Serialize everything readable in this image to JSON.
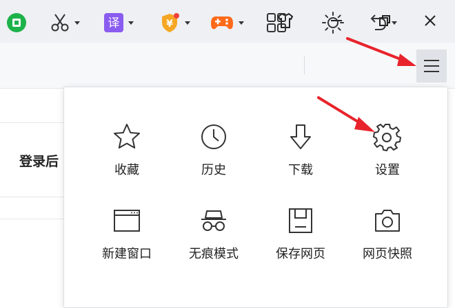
{
  "window": {
    "controls": [
      {
        "name": "skin-icon"
      },
      {
        "name": "minimize-icon"
      },
      {
        "name": "restore-icon"
      },
      {
        "name": "close-icon"
      }
    ]
  },
  "toolbar": {
    "tools": [
      {
        "name": "green-app-icon",
        "color": "#1db24a"
      },
      {
        "name": "scissors-icon",
        "color": "#333333"
      },
      {
        "name": "translate-icon",
        "glyph": "译",
        "color": "#8a5cf0"
      },
      {
        "name": "coupon-shield-icon",
        "glyph": "¥",
        "color": "#f5a623"
      },
      {
        "name": "game-controller-icon",
        "color": "#ff6a1a"
      },
      {
        "name": "grid-apps-icon",
        "color": "#333333"
      },
      {
        "name": "brightness-icon",
        "color": "#333333"
      },
      {
        "name": "undo-icon",
        "color": "#333333"
      },
      {
        "name": "hamburger-menu-icon",
        "color": "#333333"
      }
    ]
  },
  "background": {
    "partial_text": "登录后"
  },
  "menu": {
    "row1": [
      {
        "label": "收藏",
        "icon": "star-icon"
      },
      {
        "label": "历史",
        "icon": "clock-icon"
      },
      {
        "label": "下载",
        "icon": "download-arrow-icon"
      },
      {
        "label": "设置",
        "icon": "gear-icon"
      }
    ],
    "row2": [
      {
        "label": "新建窗口",
        "icon": "new-window-icon"
      },
      {
        "label": "无痕模式",
        "icon": "incognito-icon"
      },
      {
        "label": "保存网页",
        "icon": "save-page-icon"
      },
      {
        "label": "网页快照",
        "icon": "camera-icon"
      }
    ]
  },
  "annotation": {
    "arrow_color": "#e8232b"
  }
}
